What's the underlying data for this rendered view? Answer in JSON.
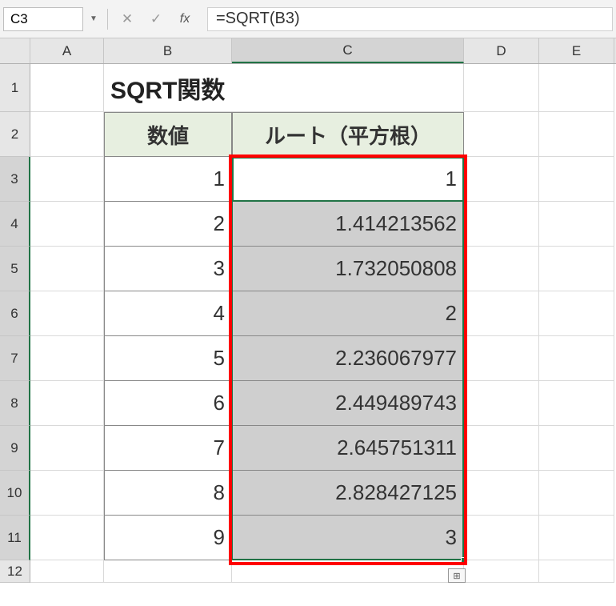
{
  "nameBox": "C3",
  "formula": "=SQRT(B3)",
  "columns": [
    "A",
    "B",
    "C",
    "D",
    "E"
  ],
  "activeColumn": "C",
  "title": "SQRT関数",
  "headers": {
    "b": "数値",
    "c": "ルート（平方根）"
  },
  "rows": [
    {
      "n": 1,
      "b": "",
      "c": ""
    },
    {
      "n": 2,
      "b": "",
      "c": ""
    },
    {
      "n": 3,
      "b": "1",
      "c": "1"
    },
    {
      "n": 4,
      "b": "2",
      "c": "1.414213562"
    },
    {
      "n": 5,
      "b": "3",
      "c": "1.732050808"
    },
    {
      "n": 6,
      "b": "4",
      "c": "2"
    },
    {
      "n": 7,
      "b": "5",
      "c": "2.236067977"
    },
    {
      "n": 8,
      "b": "6",
      "c": "2.449489743"
    },
    {
      "n": 9,
      "b": "7",
      "c": "2.645751311"
    },
    {
      "n": 10,
      "b": "8",
      "c": "2.828427125"
    },
    {
      "n": 11,
      "b": "9",
      "c": "3"
    },
    {
      "n": 12,
      "b": "",
      "c": ""
    }
  ],
  "activeRowStart": 3,
  "activeRowEnd": 11,
  "icons": {
    "cancel": "✕",
    "confirm": "✓",
    "fx": "fx",
    "dropdown": "▼",
    "autofill": "⊞"
  }
}
